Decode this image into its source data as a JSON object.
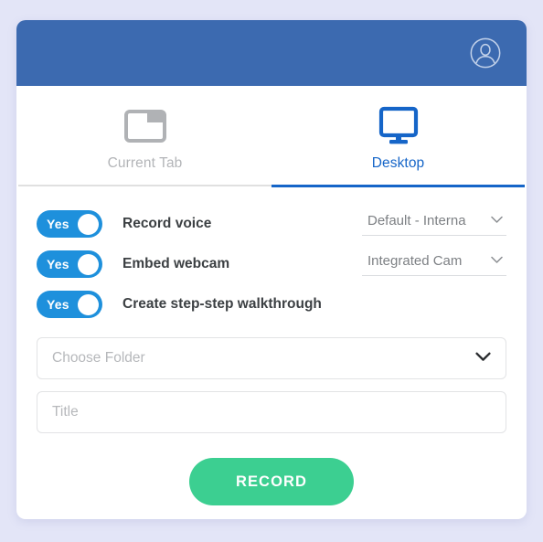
{
  "colors": {
    "page_background": "#e3e5f7",
    "header_blue": "#3c6ab0",
    "active_tab_blue": "#1565c8",
    "toggle_on_blue": "#1e90dc",
    "record_green": "#3ccf91",
    "inactive_gray": "#b3b5b8"
  },
  "header": {
    "account_icon": "user-circle-icon"
  },
  "tabs": [
    {
      "label": "Current Tab",
      "icon": "browser-tab-icon",
      "active": false
    },
    {
      "label": "Desktop",
      "icon": "monitor-icon",
      "active": true
    }
  ],
  "options": [
    {
      "toggle_value": "Yes",
      "label": "Record voice",
      "select": {
        "value": "Default - Interna",
        "icon": "chevron-down-icon"
      }
    },
    {
      "toggle_value": "Yes",
      "label": "Embed webcam",
      "select": {
        "value": "Integrated Cam",
        "icon": "chevron-down-icon"
      }
    },
    {
      "toggle_value": "Yes",
      "label": "Create step-step walkthrough",
      "select": null
    }
  ],
  "fields": {
    "folder": {
      "placeholder": "Choose Folder",
      "value": "",
      "icon": "chevron-down-icon"
    },
    "title": {
      "placeholder": "Title",
      "value": ""
    }
  },
  "actions": {
    "record_label": "RECORD"
  }
}
